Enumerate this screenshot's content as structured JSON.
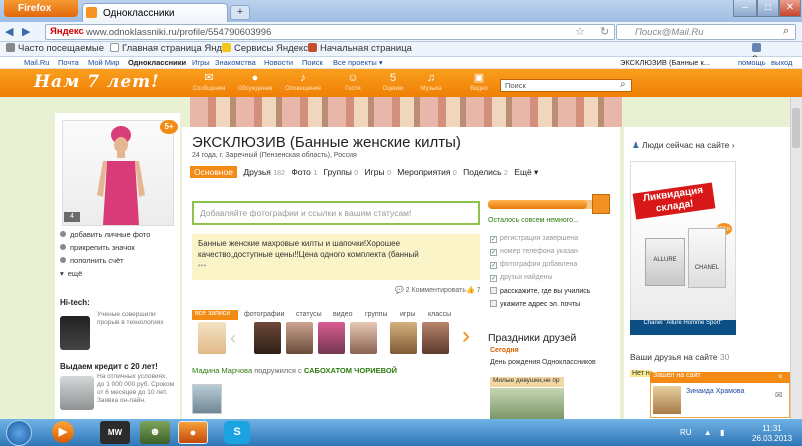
{
  "browser": {
    "menu_label": "Firefox",
    "tab_title": "Одноклассники",
    "new_tab": "+",
    "url": "www.odnoklassniki.ru/profile/554790603996",
    "url_brand": "Яндекс",
    "search_placeholder": "Поиск@Mail.Ru",
    "bookmarks": [
      "Часто посещаемые",
      "Главная страница Янд...",
      "Сервисы Яндекса",
      "Начальная страница"
    ],
    "bookmarks_right": "Закладки"
  },
  "portal": {
    "links": [
      "Mail.Ru",
      "Почта",
      "Мой Мир",
      "Одноклассники",
      "Игры",
      "Знакомства",
      "Новости",
      "Поиск",
      "Все проекты ▾"
    ],
    "user": "ЭКСКЛЮЗИВ (Банные к...",
    "help": "помощь",
    "logout": "выход"
  },
  "header": {
    "logo": "Нам 7 лет!",
    "icons": [
      {
        "glyph": "✉",
        "label": "Сообщения"
      },
      {
        "glyph": "●",
        "label": "Обсуждения"
      },
      {
        "glyph": "♪",
        "label": "Оповещения"
      },
      {
        "glyph": "☺",
        "label": "Гости"
      },
      {
        "glyph": "5",
        "label": "Оценки"
      },
      {
        "glyph": "♫",
        "label": "Музыка"
      },
      {
        "glyph": "▣",
        "label": "Видео"
      }
    ],
    "search_placeholder": "Поиск"
  },
  "profile": {
    "badge": "5+",
    "photo_count": "4",
    "name": "ЭКСКЛЮЗИВ (Банные женские килты)",
    "info": "24 года, г. Заречный (Пензенская область), Россия",
    "tabs": [
      {
        "label": "Основное",
        "count": ""
      },
      {
        "label": "Друзья",
        "count": "182"
      },
      {
        "label": "Фото",
        "count": "1"
      },
      {
        "label": "Группы",
        "count": "0"
      },
      {
        "label": "Игры",
        "count": "0"
      },
      {
        "label": "Мероприятия",
        "count": "0"
      },
      {
        "label": "Поделись",
        "count": "2"
      },
      {
        "label": "Ещё ▾",
        "count": ""
      }
    ],
    "left_menu": [
      "добавить личные фото",
      "прикрепить значок",
      "пополнить счёт",
      "ещё"
    ],
    "status_placeholder": "Добавляйте фотографии и ссылки к вашим статусам!",
    "note": "Банные женские махровые килты и шапочки!Хорошее качество,доступные цены!!Цена одного комплекта (банный",
    "note_more": "•••",
    "comments": "2 Комментировать",
    "likes": "7"
  },
  "sidebar_left": {
    "hitech_title": "Hi-tech:",
    "hitech_text": "Ученые совершили прорыв в технологиях",
    "credit_title": "Выдаем кредит с 20 лет!",
    "credit_text": "На отличных условиях, до 1 000 000 руб. Сроком от 6 месяцев до 10 лет. Заявка он-лайн."
  },
  "feed": {
    "filters": [
      "все записи",
      "фотографии",
      "статусы",
      "видео",
      "группы",
      "игры",
      "классы"
    ],
    "actor": "Мадина Марчова",
    "action": "подружился с",
    "target": "САБОХАТОМ ЧОРИЕВОЙ"
  },
  "progress": {
    "value_percent": 85,
    "label": "Осталось совсем немного...",
    "items": [
      {
        "label": "регистрация завершена",
        "done": true
      },
      {
        "label": "номер телефона указан",
        "done": true
      },
      {
        "label": "фотография добавлена",
        "done": true
      },
      {
        "label": "друзья найдены",
        "done": true
      },
      {
        "label": "расскажите, где вы учились",
        "done": false
      },
      {
        "label": "укажите адрес эл. почты",
        "done": false
      }
    ]
  },
  "holidays": {
    "title": "Праздники друзей",
    "today": "Сегодня",
    "event": "День рождения Одноклассников",
    "girls": "Милые девушки,не пр"
  },
  "right": {
    "people_now": "Люди сейчас на сайте ›",
    "ad_headline": "Ликвидация склада!",
    "ad_price": "660 р.",
    "ad_product": "ALLURE",
    "ad_brand": "CHANEL",
    "ad_footer": "Chanel \"Allure Homme Sport\"",
    "friends_on_site": "Ваши друзья на сайте",
    "friends_count": "30",
    "nobody": "Нет н",
    "online_title": "Зашел на сайт",
    "online_name": "Зинаида Храмова"
  },
  "taskbar": {
    "lang": "RU",
    "time": "11:31",
    "date": "26.03.2013"
  }
}
